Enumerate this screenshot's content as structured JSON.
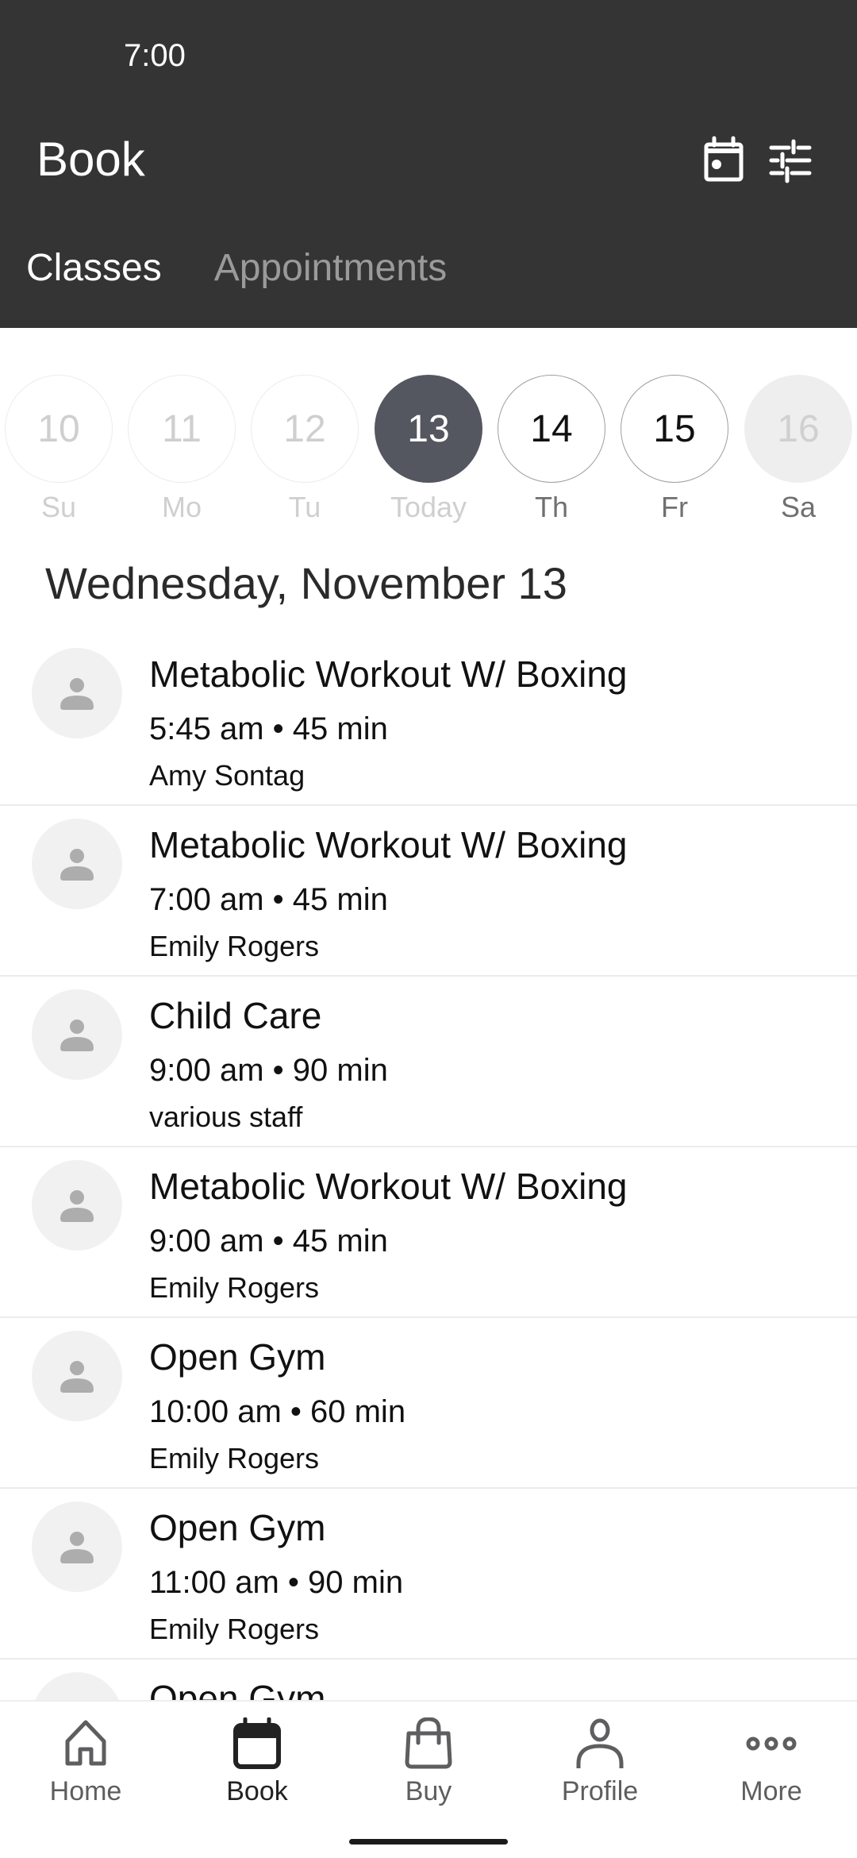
{
  "status_bar": {
    "time": "7:00"
  },
  "header": {
    "title": "Book",
    "icons": [
      "calendar-icon",
      "filter-sliders-icon"
    ]
  },
  "tabs": [
    {
      "label": "Classes",
      "active": true
    },
    {
      "label": "Appointments",
      "active": false
    }
  ],
  "date_strip": [
    {
      "day": "10",
      "label": "Su",
      "state": "past"
    },
    {
      "day": "11",
      "label": "Mo",
      "state": "past"
    },
    {
      "day": "12",
      "label": "Tu",
      "state": "past"
    },
    {
      "day": "13",
      "label": "Today",
      "state": "today"
    },
    {
      "day": "14",
      "label": "Th",
      "state": "future"
    },
    {
      "day": "15",
      "label": "Fr",
      "state": "future"
    },
    {
      "day": "16",
      "label": "Sa",
      "state": "unavailable"
    }
  ],
  "date_heading": "Wednesday, November 13",
  "classes": [
    {
      "title": "Metabolic Workout W/ Boxing",
      "time": "5:45 am • 45 min",
      "staff": "Amy Sontag"
    },
    {
      "title": "Metabolic Workout W/ Boxing",
      "time": "7:00 am • 45 min",
      "staff": "Emily Rogers"
    },
    {
      "title": "Child Care",
      "time": "9:00 am • 90 min",
      "staff": "various staff"
    },
    {
      "title": "Metabolic Workout W/ Boxing",
      "time": "9:00 am • 45 min",
      "staff": "Emily Rogers"
    },
    {
      "title": "Open Gym",
      "time": "10:00 am • 60 min",
      "staff": "Emily Rogers"
    },
    {
      "title": "Open Gym",
      "time": "11:00 am • 90 min",
      "staff": "Emily Rogers"
    },
    {
      "title": "Open Gym",
      "time": "",
      "staff": ""
    }
  ],
  "bottom_nav": [
    {
      "label": "Home",
      "icon": "home-icon",
      "active": false
    },
    {
      "label": "Book",
      "icon": "calendar-icon",
      "active": true
    },
    {
      "label": "Buy",
      "icon": "shopping-bag-icon",
      "active": false
    },
    {
      "label": "Profile",
      "icon": "person-icon",
      "active": false
    },
    {
      "label": "More",
      "icon": "more-dots-icon",
      "active": false
    }
  ],
  "colors": {
    "header_bg": "#353435",
    "today_bg": "#545660",
    "avatar_bg": "#f1f1f1",
    "inactive_tab": "#9a9a9a"
  }
}
